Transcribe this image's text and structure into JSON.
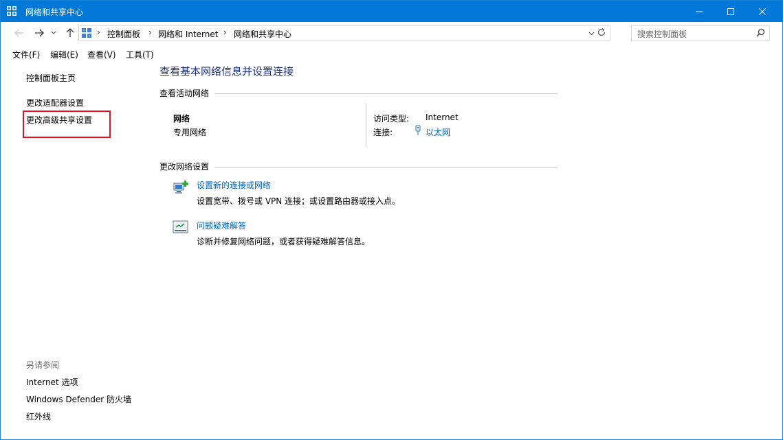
{
  "window": {
    "title": "网络和共享中心"
  },
  "address_bar": {
    "breadcrumbs": [
      "控制面板",
      "网络和 Internet",
      "网络和共享中心"
    ]
  },
  "search": {
    "placeholder": "搜索控制面板"
  },
  "menu": [
    "文件(F)",
    "编辑(E)",
    "查看(V)",
    "工具(T)"
  ],
  "sidebar": {
    "home": "控制面板主页",
    "items": [
      "更改适配器设置",
      "更改高级共享设置"
    ],
    "see_also_label": "另请参阅",
    "see_also": [
      "Internet 选项",
      "Windows Defender 防火墙",
      "红外线"
    ]
  },
  "main": {
    "heading": "查看基本网络信息并设置连接",
    "active_networks_label": "查看活动网络",
    "network": {
      "name": "网络",
      "type": "专用网络",
      "access_type_label": "访问类型:",
      "access_type_value": "Internet",
      "connections_label": "连接:",
      "connection_value": "以太网"
    },
    "change_settings_label": "更改网络设置",
    "tasks": [
      {
        "title": "设置新的连接或网络",
        "description": "设置宽带、拨号或 VPN 连接；或设置路由器或接入点。"
      },
      {
        "title": "问题疑难解答",
        "description": "诊断并修复网络问题，或者获得疑难解答信息。"
      }
    ]
  },
  "colors": {
    "titlebar": "#0078d7",
    "link": "#0066cc",
    "heading": "#1e3287",
    "highlight_box": "#e81123"
  }
}
